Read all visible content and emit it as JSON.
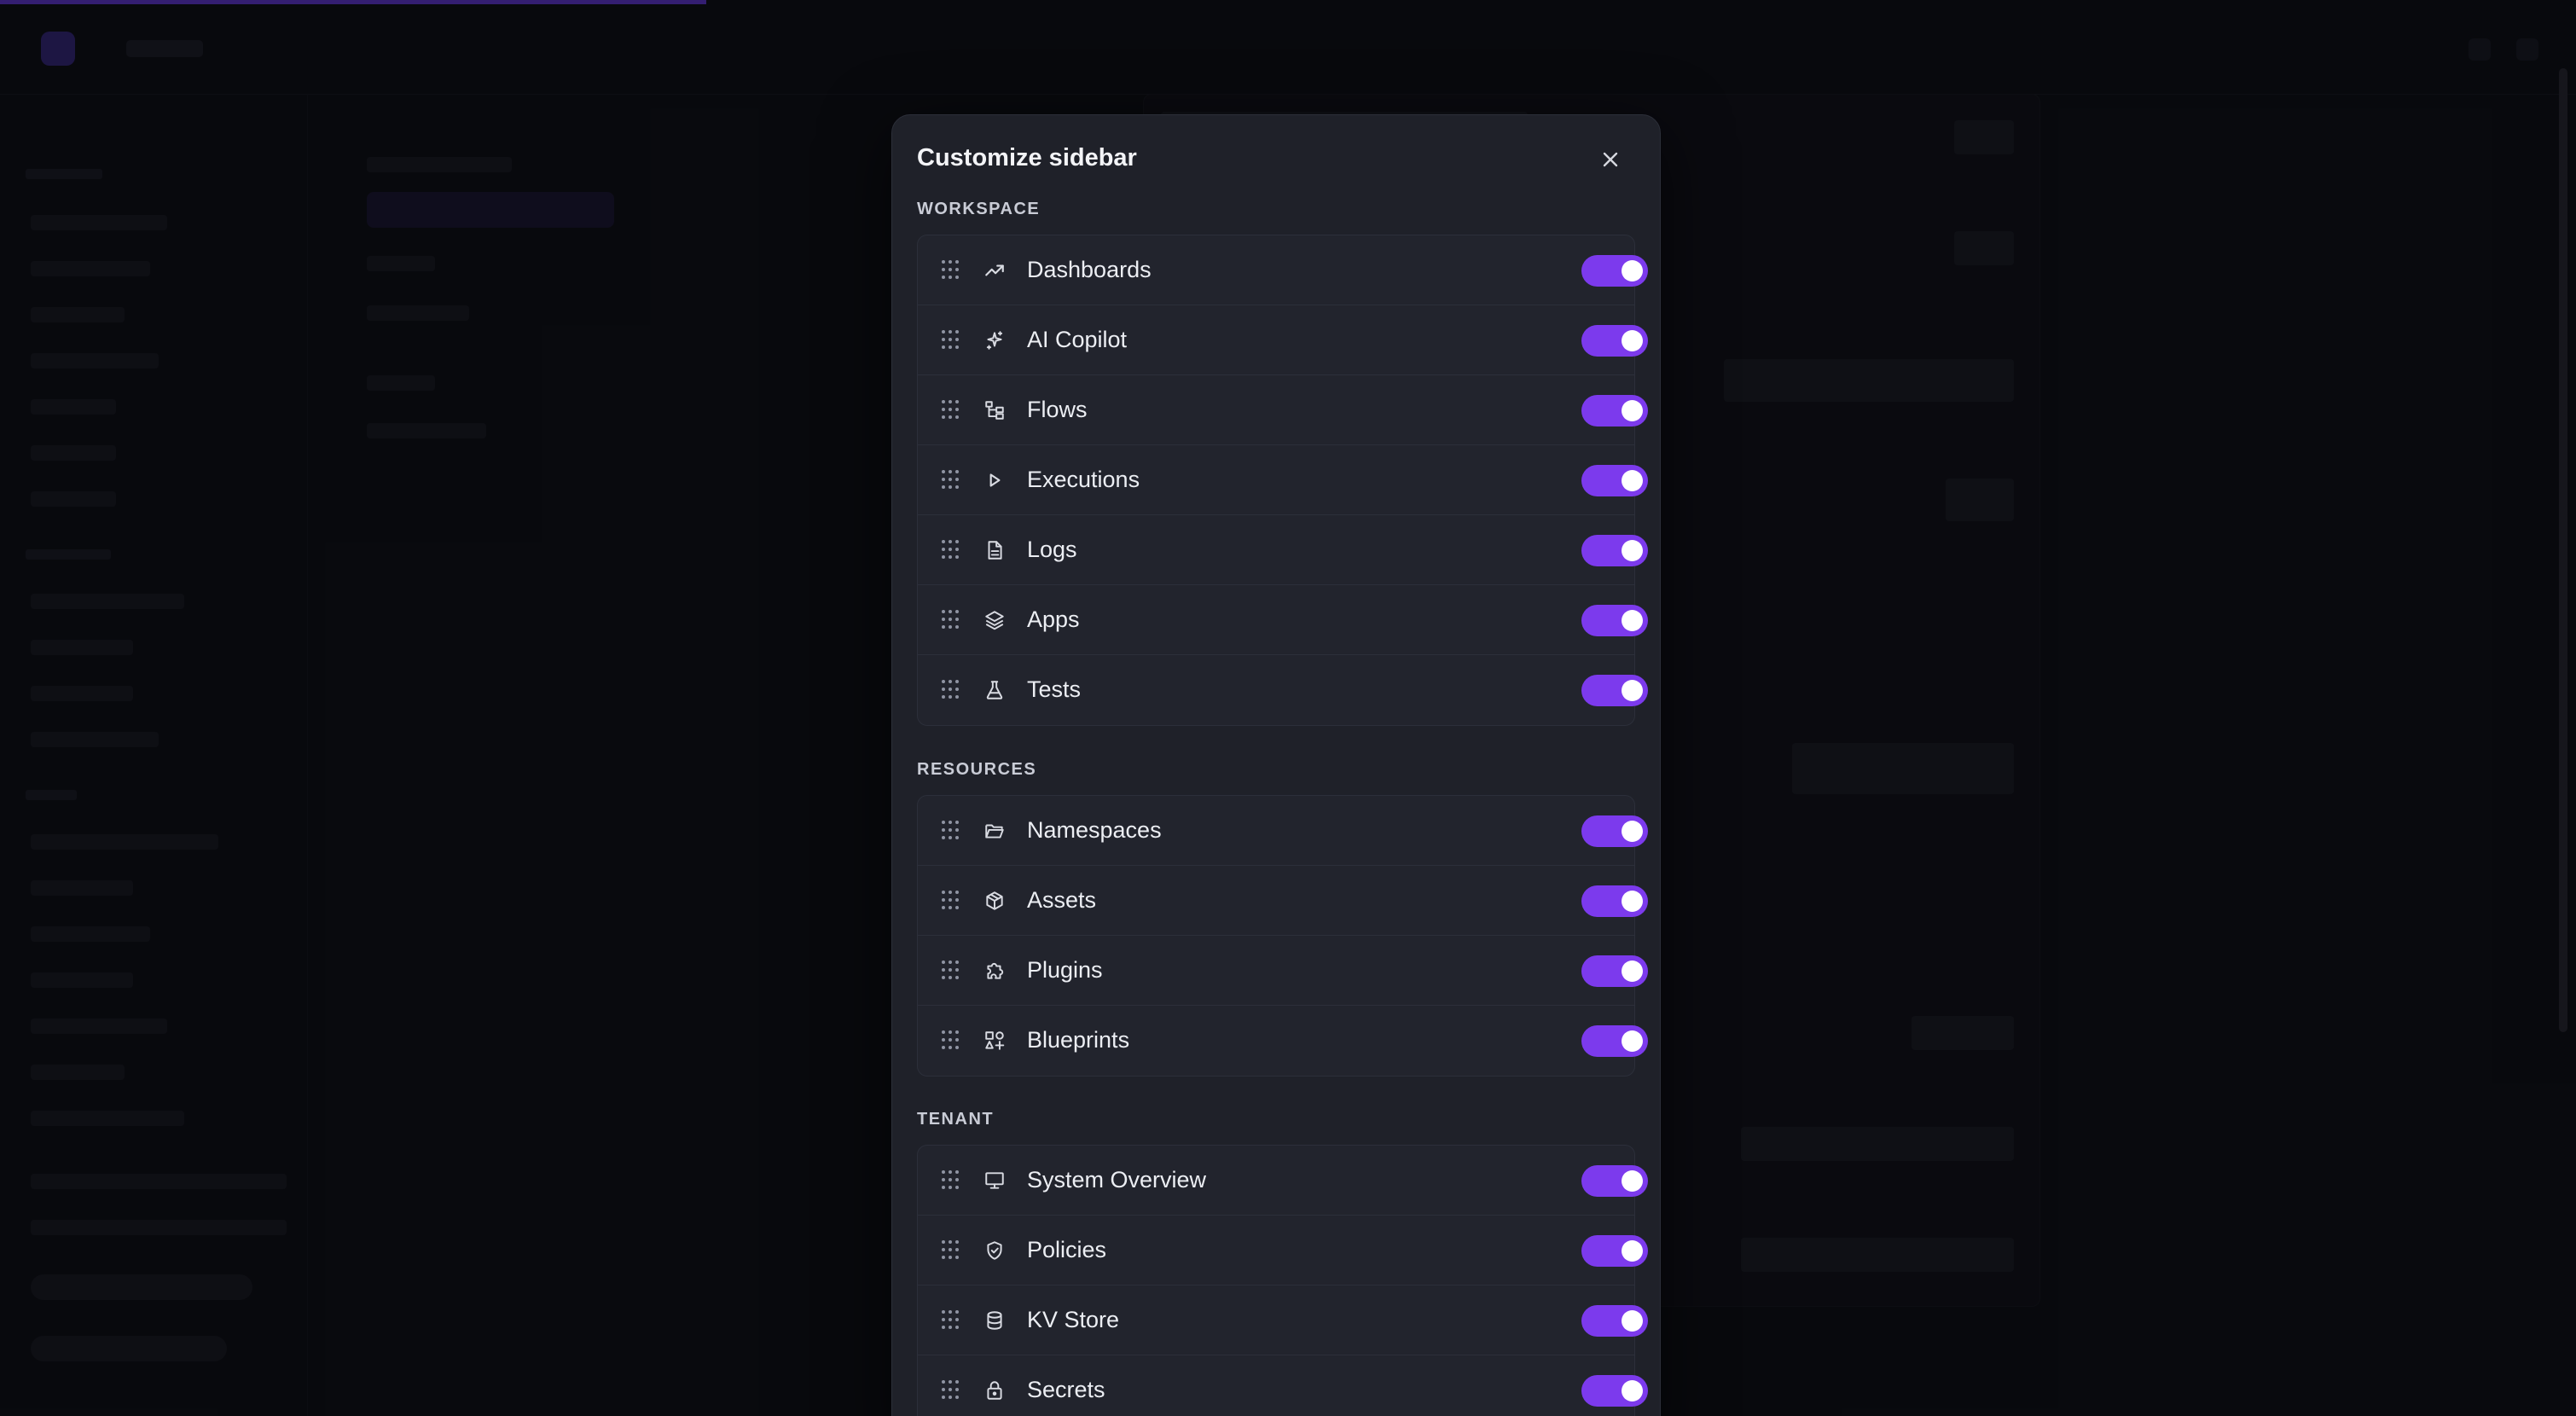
{
  "modal": {
    "title": "Customize sidebar",
    "sections": [
      {
        "label": "WORKSPACE",
        "items": [
          {
            "label": "Dashboards",
            "icon": "chart-line-icon",
            "enabled": true
          },
          {
            "label": "AI Copilot",
            "icon": "ai-sparkle-icon",
            "enabled": true
          },
          {
            "label": "Flows",
            "icon": "flow-tree-icon",
            "enabled": true
          },
          {
            "label": "Executions",
            "icon": "play-icon",
            "enabled": true
          },
          {
            "label": "Logs",
            "icon": "file-text-icon",
            "enabled": true
          },
          {
            "label": "Apps",
            "icon": "layers-icon",
            "enabled": true
          },
          {
            "label": "Tests",
            "icon": "flask-icon",
            "enabled": true
          }
        ]
      },
      {
        "label": "RESOURCES",
        "items": [
          {
            "label": "Namespaces",
            "icon": "folder-open-icon",
            "enabled": true
          },
          {
            "label": "Assets",
            "icon": "cube-icon",
            "enabled": true
          },
          {
            "label": "Plugins",
            "icon": "puzzle-icon",
            "enabled": true
          },
          {
            "label": "Blueprints",
            "icon": "shapes-icon",
            "enabled": true
          }
        ]
      },
      {
        "label": "TENANT",
        "items": [
          {
            "label": "System Overview",
            "icon": "monitor-icon",
            "enabled": true
          },
          {
            "label": "Policies",
            "icon": "shield-check-icon",
            "enabled": true
          },
          {
            "label": "KV Store",
            "icon": "database-icon",
            "enabled": true
          },
          {
            "label": "Secrets",
            "icon": "lock-icon",
            "enabled": true
          }
        ]
      }
    ]
  },
  "colors": {
    "accent": "#7c3aed",
    "modal_bg": "#1f2129",
    "page_bg": "#0d0e13"
  }
}
